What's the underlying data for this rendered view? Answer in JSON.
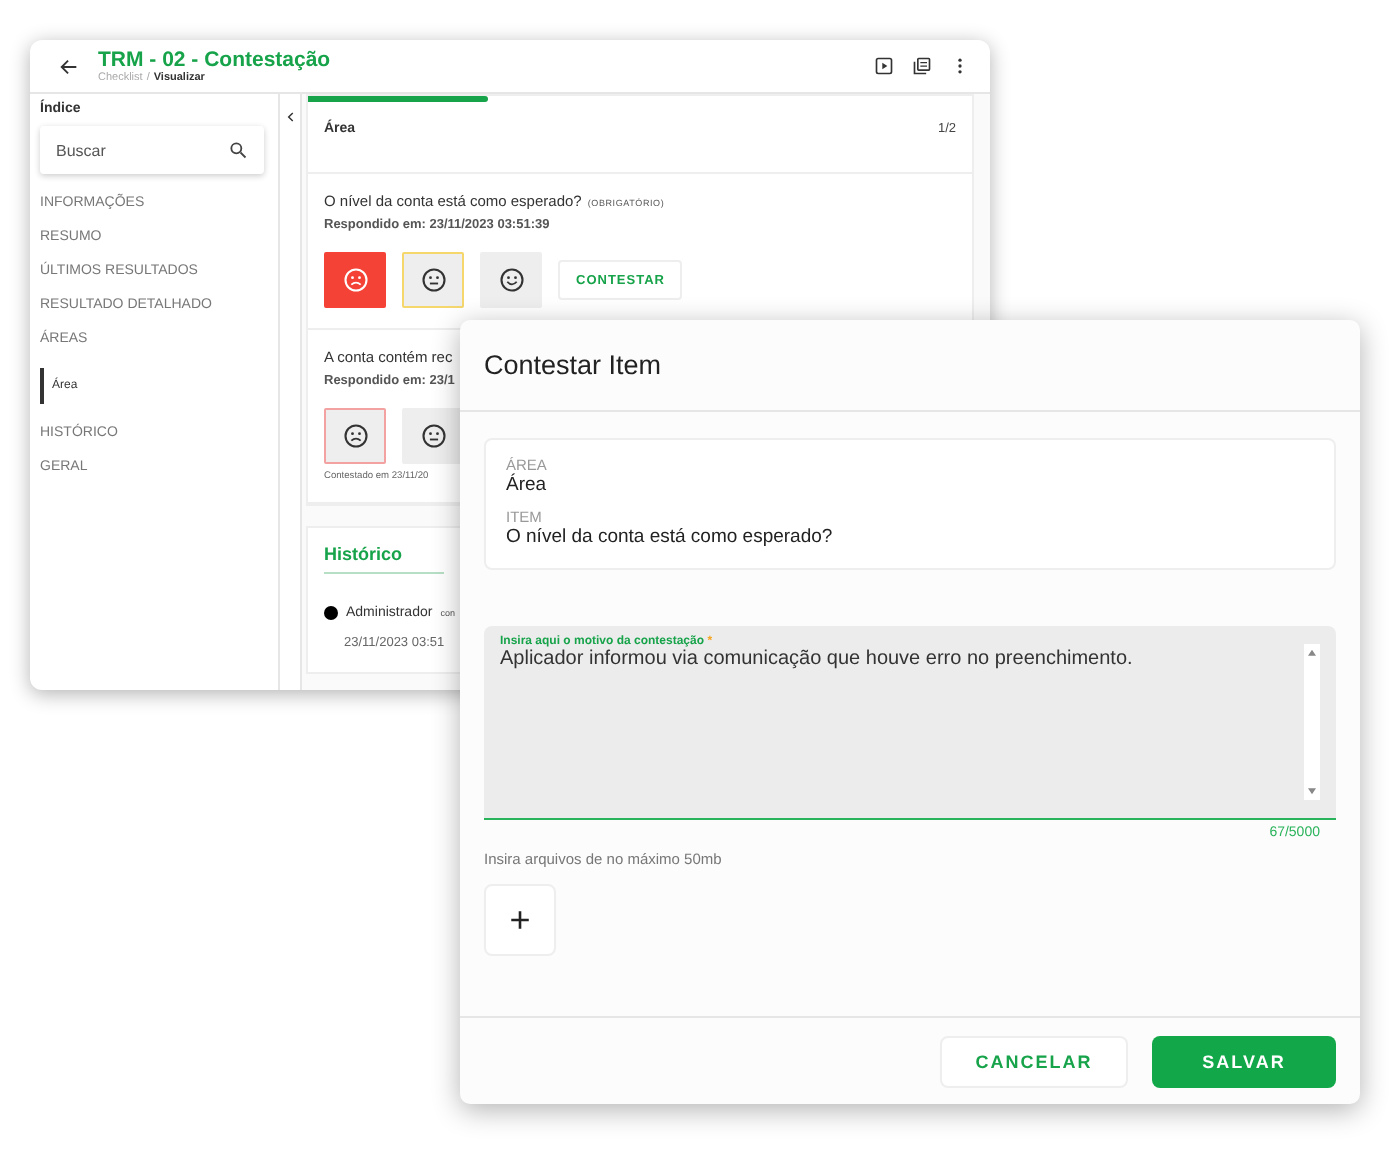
{
  "window": {
    "title": "TRM - 02 - Contestação",
    "breadcrumb": {
      "parent": "Checklist",
      "separator": "/",
      "current": "Visualizar"
    }
  },
  "sidebar": {
    "heading": "Índice",
    "search_placeholder": "Buscar",
    "items": [
      {
        "label": "INFORMAÇÕES",
        "selected": false
      },
      {
        "label": "RESUMO",
        "selected": false
      },
      {
        "label": "ÚLTIMOS RESULTADOS",
        "selected": false
      },
      {
        "label": "RESULTADO DETALHADO",
        "selected": false
      },
      {
        "label": "ÁREAS",
        "selected": false,
        "children": [
          {
            "label": "Área",
            "selected": true
          }
        ]
      },
      {
        "label": "HISTÓRICO",
        "selected": false
      },
      {
        "label": "GERAL",
        "selected": false
      }
    ]
  },
  "content": {
    "progress": {
      "level": 0.27
    },
    "section": {
      "title": "Área",
      "page": "1/2"
    },
    "questions": [
      {
        "text": "O nível da conta está como esperado?",
        "tag": "(OBRIGATÓRIO)",
        "answered": "Respondido em: 23/11/2023 03:51:39",
        "options": [
          {
            "kind": "sad",
            "selected": true,
            "highlighted": false,
            "contested": false
          },
          {
            "kind": "neutral",
            "selected": false,
            "highlighted": true,
            "contested": false
          },
          {
            "kind": "happy",
            "selected": false,
            "highlighted": false,
            "contested": false
          }
        ],
        "action": "CONTESTAR"
      },
      {
        "text": "A conta contém rec",
        "answered": "Respondido em: 23/1",
        "options": [
          {
            "kind": "sad",
            "selected": false,
            "highlighted": false,
            "contested": true
          },
          {
            "kind": "neutral",
            "selected": false,
            "highlighted": false,
            "contested": false
          }
        ],
        "note": "Contestado em 23/11/20"
      }
    ],
    "history": {
      "title": "Histórico",
      "entries": [
        {
          "user": "Administrador",
          "action": "con",
          "time": "23/11/2023 03:51"
        }
      ]
    }
  },
  "dialog": {
    "title": "Contestar Item",
    "info": [
      {
        "label": "ÁREA",
        "value": "Área"
      },
      {
        "label": "ITEM",
        "value": "O nível da conta está como esperado?"
      }
    ],
    "reason": {
      "label": "Insira aqui o motivo da contestação",
      "required_mark": "*",
      "value": "Aplicador informou via comunicação que houve erro no preenchimento.",
      "counter": "67/5000"
    },
    "files_hint": "Insira arquivos de no máximo 50mb",
    "add_symbol": "+",
    "buttons": [
      {
        "label": "CANCELAR",
        "kind": "secondary"
      },
      {
        "label": "SALVAR",
        "kind": "primary"
      }
    ]
  }
}
